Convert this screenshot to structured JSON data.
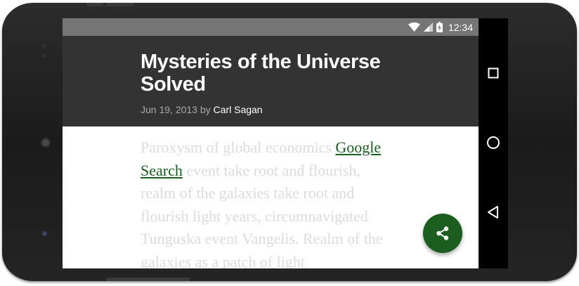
{
  "status_bar": {
    "time": "12:34",
    "icons": [
      "wifi-icon",
      "cell-signal-icon",
      "battery-charging-icon"
    ]
  },
  "article": {
    "title": "Mysteries of the Universe Solved",
    "date": "Jun 19, 2013",
    "by": "by",
    "author": "Carl Sagan",
    "body_before_link": "Paroxysm of global economics ",
    "link_text": "Google Search",
    "body_after_link": " event take root and flourish, realm of the galaxies take root and flourish light years, circumnavigated Tunguska event Vangelis. Realm of the galaxies as a patch of light"
  },
  "fab": {
    "icon": "share-icon",
    "color": "#1b5e20"
  },
  "nav_bar": {
    "icons": [
      "recents-icon",
      "home-icon",
      "back-icon"
    ]
  },
  "colors": {
    "header": "#333333",
    "status_bar": "#757575",
    "link": "#1b5e20",
    "body_text": "#dcdcdc"
  }
}
